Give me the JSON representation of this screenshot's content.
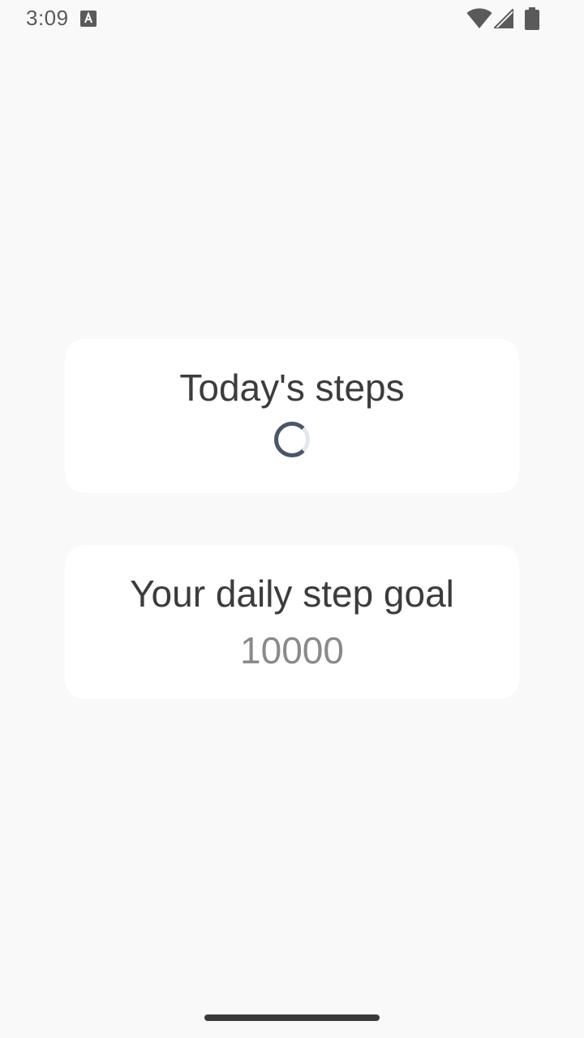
{
  "status_bar": {
    "time": "3:09",
    "icons": [
      "notification-a-icon",
      "wifi-icon",
      "signal-icon",
      "battery-icon"
    ]
  },
  "steps_card": {
    "title": "Today's steps",
    "state": "loading"
  },
  "goal_card": {
    "title": "Your daily step goal",
    "value": "10000"
  },
  "colors": {
    "background": "#f9f9f9",
    "card": "#ffffff",
    "spinner": "#4b5568",
    "spinner_track": "#e3e6ee",
    "goal_value": "#8a8a8a"
  }
}
